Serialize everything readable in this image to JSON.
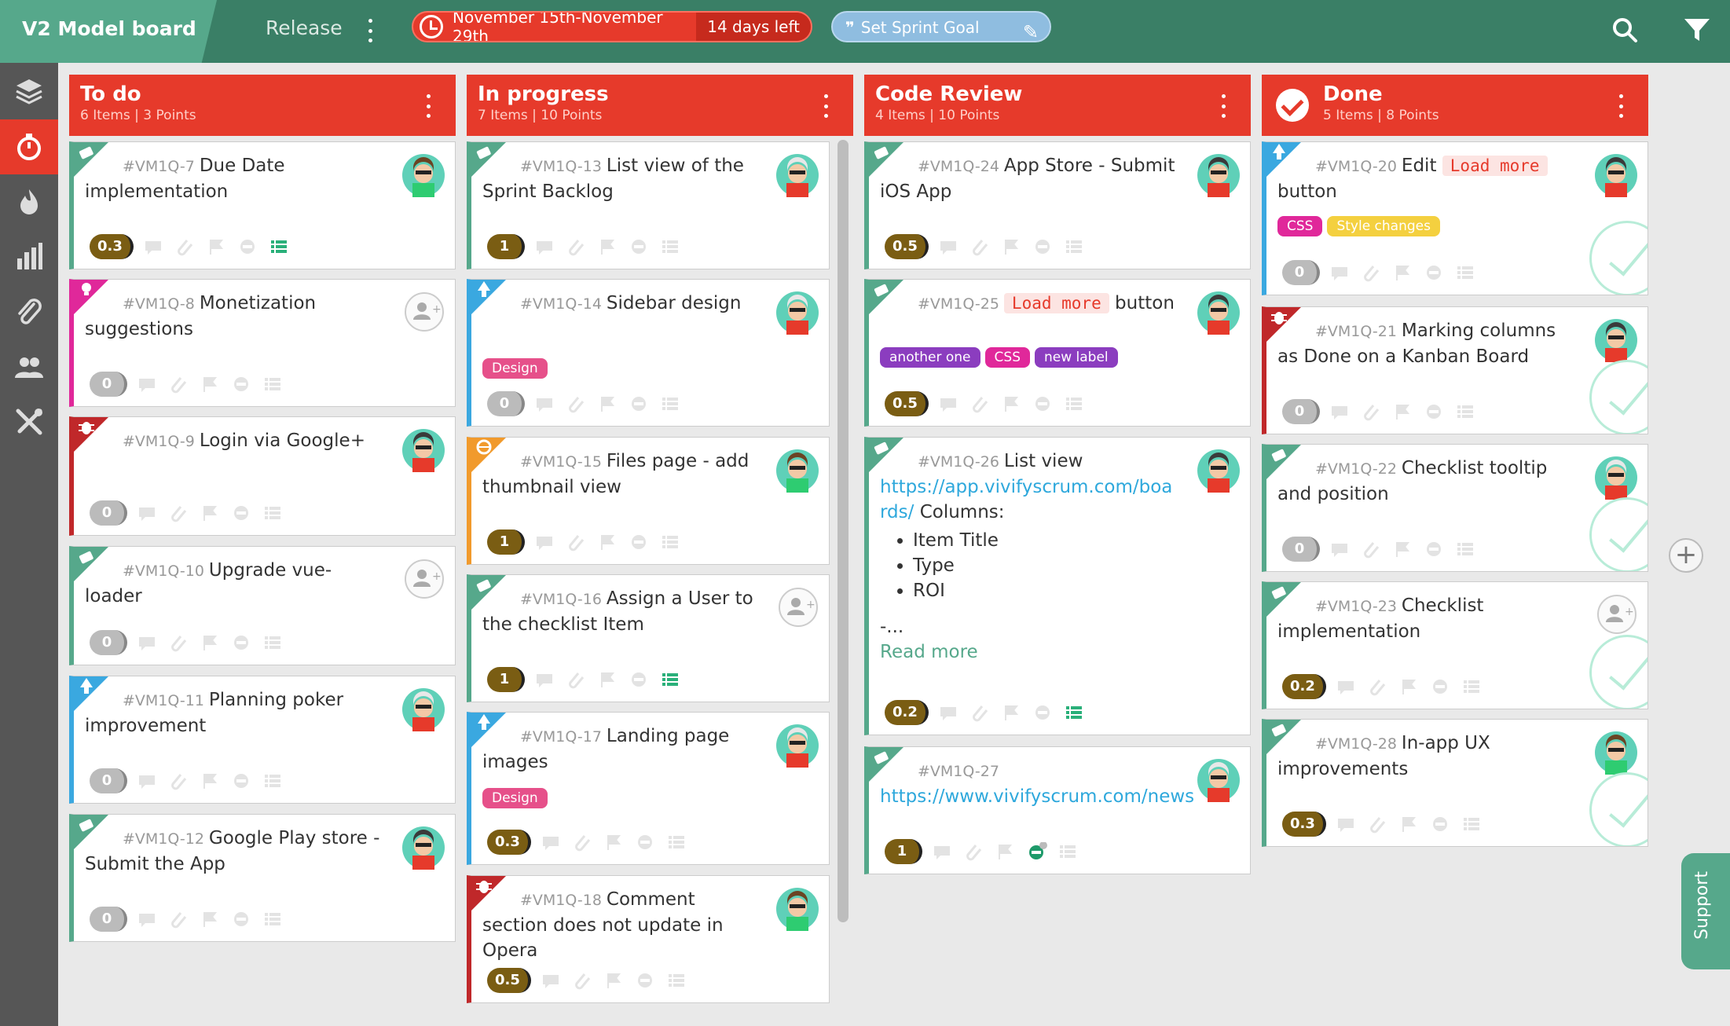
{
  "topbar": {
    "board_title": "V2 Model board",
    "release_label": "Release",
    "sprint_dates": "November 15th-November 29th",
    "days_left": "14 days left",
    "goal_quote": "❞",
    "sprint_goal": "Set Sprint Goal"
  },
  "colors": {
    "accent": "#e63a2b",
    "green": "#56a88b",
    "topbar": "#3a7f66"
  },
  "sidebar": {
    "items": [
      "layers-icon",
      "stopwatch-icon",
      "fire-icon",
      "bar-chart-icon",
      "paperclip-icon",
      "team-icon",
      "tools-icon"
    ],
    "active": "stopwatch-icon"
  },
  "columns": [
    {
      "title": "To do",
      "summary": "6 Items | 3 Points"
    },
    {
      "title": "In progress",
      "summary": "7 Items | 10 Points"
    },
    {
      "title": "Code Review",
      "summary": "4 Items | 10 Points"
    },
    {
      "title": "Done",
      "summary": "5 Items | 8 Points"
    }
  ],
  "cards": {
    "c7": {
      "id": "#VM1Q-7",
      "title": "Due Date implementation",
      "points": "0.3"
    },
    "c8": {
      "id": "#VM1Q-8",
      "title": "Monetization suggestions",
      "points": "0"
    },
    "c9": {
      "id": "#VM1Q-9",
      "title": "Login via Google+",
      "points": "0"
    },
    "c10": {
      "id": "#VM1Q-10",
      "title": "Upgrade vue-loader",
      "points": "0"
    },
    "c11": {
      "id": "#VM1Q-11",
      "title": "Planning poker improvement",
      "points": "0"
    },
    "c12": {
      "id": "#VM1Q-12",
      "title": "Google Play store - Submit the App",
      "points": "0"
    },
    "c13": {
      "id": "#VM1Q-13",
      "title": "List view of the Sprint Backlog",
      "points": "1"
    },
    "c14": {
      "id": "#VM1Q-14",
      "title": "Sidebar design",
      "points": "0",
      "labels": [
        "Design"
      ]
    },
    "c15": {
      "id": "#VM1Q-15",
      "title": "Files page - add thumbnail view",
      "points": "1"
    },
    "c16": {
      "id": "#VM1Q-16",
      "title": "Assign a User to the checklist Item",
      "points": "1"
    },
    "c17": {
      "id": "#VM1Q-17",
      "title": "Landing page images",
      "points": "0.3",
      "labels": [
        "Design"
      ]
    },
    "c18": {
      "id": "#VM1Q-18",
      "title": "Comment section does not update in Opera",
      "points": "0.5"
    },
    "c24": {
      "id": "#VM1Q-24",
      "title": "App Store - Submit iOS App",
      "points": "0.5"
    },
    "c25": {
      "id": "#VM1Q-25",
      "code": "Load more",
      "title_after": "button",
      "points": "0.5",
      "labels": [
        "another one",
        "CSS",
        "new label"
      ]
    },
    "c26": {
      "id": "#VM1Q-26",
      "title": "List view",
      "link": "https://app.vivifyscrum.com/boards/",
      "after_link": " Columns:",
      "list": [
        "Item Title",
        "Type",
        "ROI"
      ],
      "ellipsis": "-...",
      "read_more": "Read more",
      "points": "0.2"
    },
    "c27": {
      "id": "#VM1Q-27",
      "link": "https://www.vivifyscrum.com/news",
      "points": "1",
      "badge": "1"
    },
    "c20": {
      "id": "#VM1Q-20",
      "title_before": "Edit",
      "code": "Load more",
      "title_after": "button",
      "points": "0",
      "labels": [
        "CSS",
        "Style changes"
      ]
    },
    "c21": {
      "id": "#VM1Q-21",
      "title": "Marking columns as Done on a Kanban Board",
      "points": "0"
    },
    "c22": {
      "id": "#VM1Q-22",
      "title": "Checklist tooltip and position",
      "points": "0"
    },
    "c23": {
      "id": "#VM1Q-23",
      "title": "Checklist implementation",
      "points": "0.2"
    },
    "c28": {
      "id": "#VM1Q-28",
      "title": "In-app UX improvements",
      "points": "0.3"
    }
  },
  "support_label": "Support"
}
